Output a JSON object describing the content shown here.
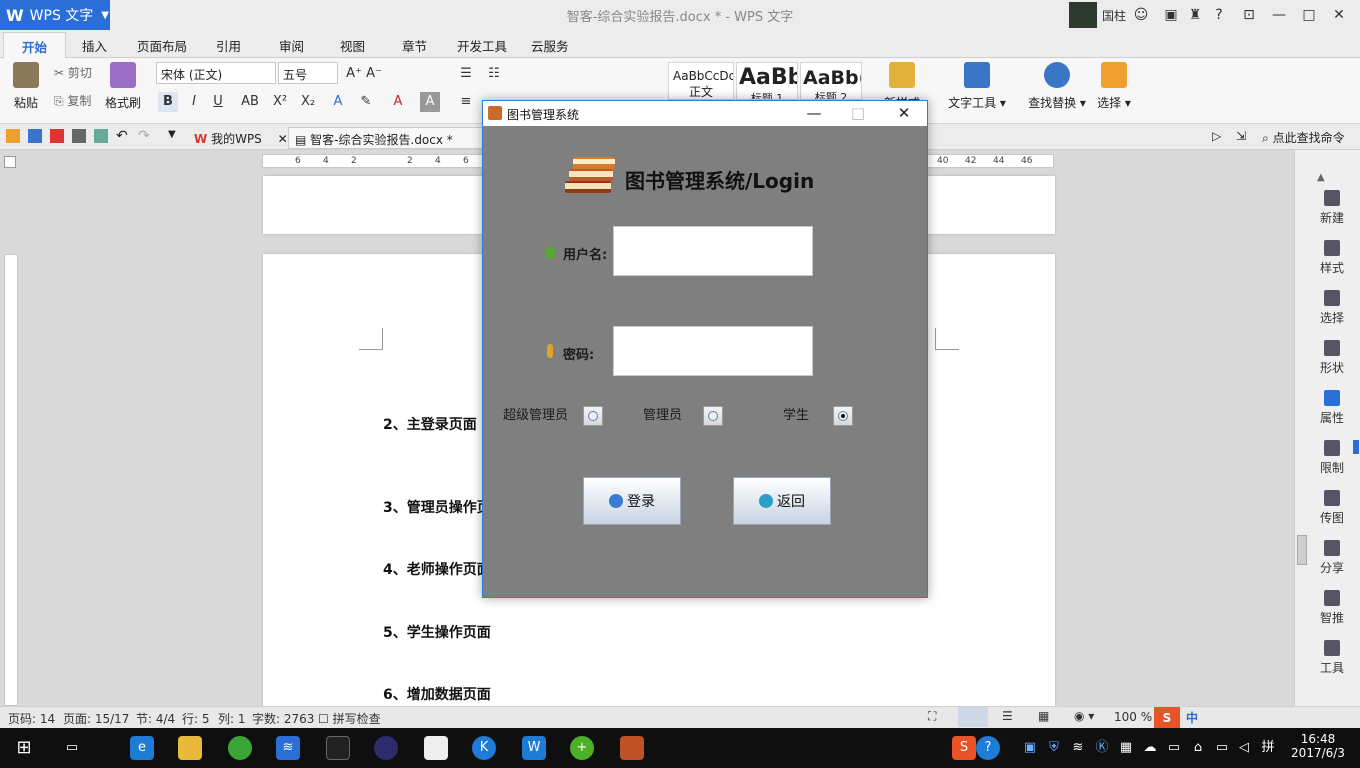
{
  "app": {
    "logo_text": "WPS 文字",
    "window_title": "智客-综合实验报告.docx * - WPS 文字",
    "user_name": "国柱"
  },
  "ribbon_tabs": [
    "开始",
    "插入",
    "页面布局",
    "引用",
    "审阅",
    "视图",
    "章节",
    "开发工具",
    "云服务"
  ],
  "ribbon": {
    "paste": "粘贴",
    "cut": "剪切",
    "copy": "复制",
    "format_painter": "格式刷",
    "font_name": "宋体 (正文)",
    "font_size": "五号",
    "styles": [
      "AaBbCcDd",
      "AaBb",
      "AaBb("
    ],
    "style_names": [
      "正文",
      "标题 1",
      "标题 2"
    ],
    "new_style": "新样式",
    "text_tools": "文字工具",
    "find_replace": "查找替换",
    "select": "选择"
  },
  "qat": {
    "tab_my_wps": "我的WPS",
    "tab_doc": "智客-综合实验报告.docx *",
    "search_cmd": "点此查找命令"
  },
  "ruler_marks": [
    "6",
    "4",
    "2",
    "2",
    "4",
    "6",
    "40",
    "42",
    "44",
    "46"
  ],
  "document": {
    "lines": [
      "2、主登录页面",
      "3、管理员操作页",
      "4、老师操作页面",
      "5、学生操作页面",
      "6、增加数据页面"
    ]
  },
  "right_panel": [
    "新建",
    "样式",
    "选择",
    "形状",
    "属性",
    "限制",
    "传图",
    "分享",
    "智推",
    "工具"
  ],
  "status": {
    "page_num": "页码: 14",
    "pages": "页面: 15/17",
    "section": "节: 4/4",
    "row": "行: 5",
    "col": "列: 1",
    "words": "字数: 2763",
    "spell": "拼写检查",
    "zoom": "100 %"
  },
  "taskbar": {
    "time": "16:48",
    "date": "2017/6/3",
    "ime": "中"
  },
  "dialog": {
    "title": "图书管理系统",
    "heading": "图书管理系统/Login",
    "username_label": "用户名:",
    "password_label": "密码:",
    "username_value": "",
    "password_value": "",
    "roles": [
      "超级管理员",
      "管理员",
      "学生"
    ],
    "selected_role": "学生",
    "login_button": "登录",
    "back_button": "返回"
  }
}
